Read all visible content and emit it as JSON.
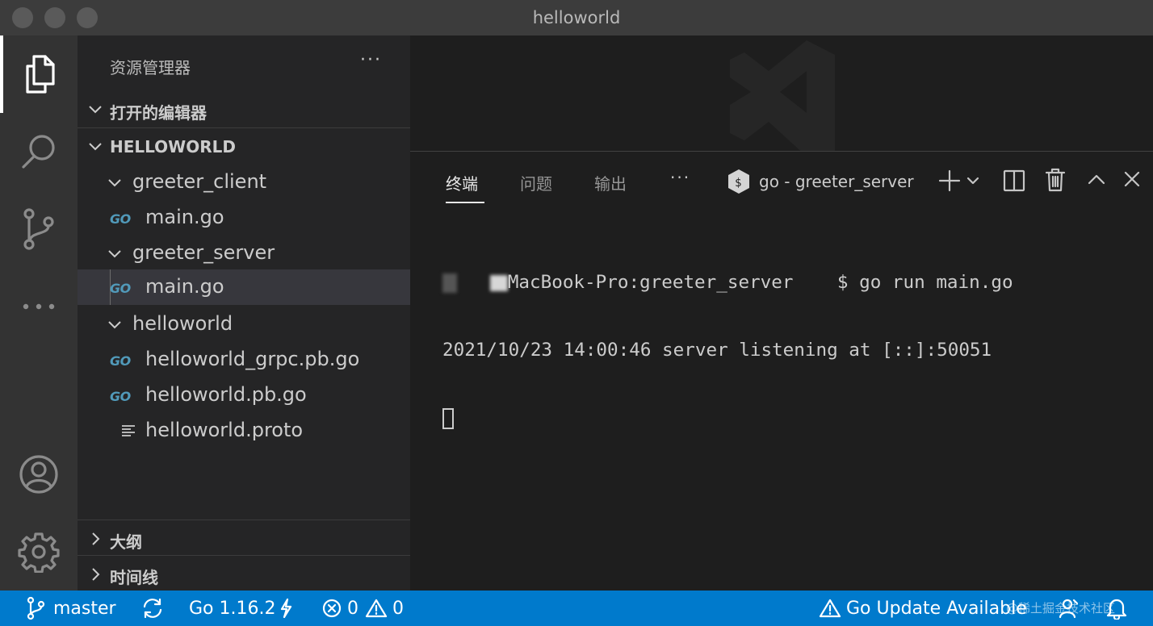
{
  "window": {
    "title": "helloworld"
  },
  "activity_bar": {
    "items": [
      {
        "name": "explorer",
        "icon": "files-icon",
        "active": true
      },
      {
        "name": "search",
        "icon": "search-icon"
      },
      {
        "name": "source-control",
        "icon": "source-control-icon"
      },
      {
        "name": "more",
        "icon": "ellipsis-icon"
      }
    ],
    "bottom": [
      {
        "name": "accounts",
        "icon": "account-icon"
      },
      {
        "name": "manage",
        "icon": "gear-icon"
      }
    ]
  },
  "sidebar": {
    "title": "资源管理器",
    "more_label": "···",
    "open_editors": "打开的编辑器",
    "workspace": "HELLOWORLD",
    "tree": [
      {
        "label": "greeter_client",
        "type": "folder"
      },
      {
        "label": "main.go",
        "type": "go"
      },
      {
        "label": "greeter_server",
        "type": "folder"
      },
      {
        "label": "main.go",
        "type": "go",
        "selected": true
      },
      {
        "label": "helloworld",
        "type": "folder"
      },
      {
        "label": "helloworld_grpc.pb.go",
        "type": "go"
      },
      {
        "label": "helloworld.pb.go",
        "type": "go"
      },
      {
        "label": "helloworld.proto",
        "type": "text"
      }
    ],
    "go_badge": "GO",
    "outline": "大纲",
    "timeline": "时间线"
  },
  "panel": {
    "tabs": [
      "终端",
      "问题",
      "输出"
    ],
    "active_tab": "终端",
    "more_label": "···",
    "terminal_name": "go - greeter_server",
    "terminal_lines": [
      {
        "host": "MacBook-Pro:greeter_server",
        "command": "$ go run main.go"
      },
      {
        "text": "2021/10/23 14:00:46 server listening at [::]:50051"
      }
    ]
  },
  "status_bar": {
    "branch": "master",
    "go_version": "Go 1.16.2",
    "errors": "0",
    "warnings": "0",
    "update": "Go Update Available",
    "credit": "@稀土掘金技术社区"
  },
  "colors": {
    "accent": "#007acc",
    "go": "#519aba",
    "sidebar_bg": "#252526",
    "activity_bg": "#333333",
    "titlebar_bg": "#3c3c3c"
  }
}
